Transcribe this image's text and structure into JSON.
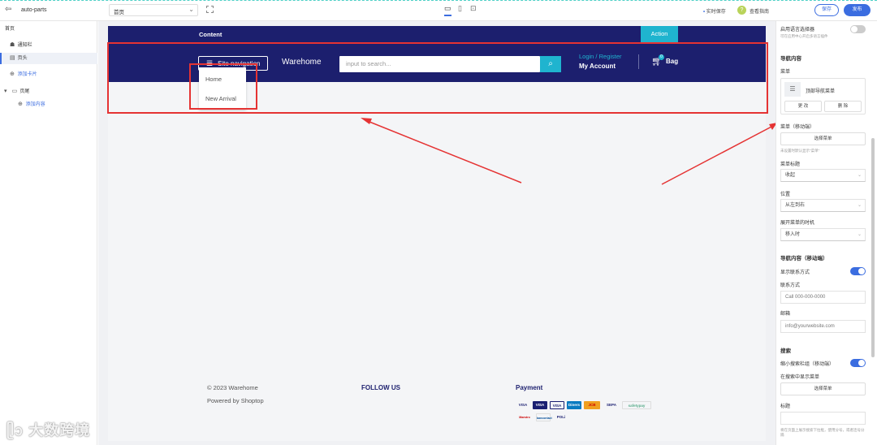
{
  "topbar": {
    "back_icon": "exit-icon",
    "site_name": "auto-parts",
    "page_select": "首页",
    "autosave_label": "实时保存",
    "help_label": "查看指南",
    "save_label": "保存",
    "publish_label": "发布"
  },
  "sidebar": {
    "items": [
      {
        "label": "首页"
      },
      {
        "label": "通知栏"
      },
      {
        "label": "页头"
      },
      {
        "label": "添加卡片"
      },
      {
        "label": "页尾"
      },
      {
        "label": "添加内容"
      }
    ]
  },
  "preview": {
    "content_label": "Content",
    "action_label": "Action",
    "site_navigation": "Site navigation",
    "brand": "Warehome",
    "search_placeholder": "input to search...",
    "login_register": "Login / Register",
    "my_account": "My Account",
    "cart_count": "0",
    "bag_label": "Bag",
    "dropdown": [
      "Home",
      "New Arrival"
    ],
    "footer": {
      "copyright": "© 2023 Warehome",
      "powered": "Powered by Shoptop",
      "follow_us": "FOLLOW US",
      "payment": "Payment",
      "payment_methods": [
        "VISA",
        "VISA",
        "VISA",
        "Diners",
        "JCB",
        "SEPA",
        "safetypay",
        "Maestro",
        "bancontact",
        "POLi"
      ]
    }
  },
  "right_panel": {
    "lang_selector_label": "启用语言选择器",
    "lang_selector_hint": "可在应用中心开启多语言插件",
    "nav_section": "导航内容",
    "menu_label": "菜单",
    "menu_name": "顶部导航菜单",
    "change_label": "更 改",
    "delete_label": "删 除",
    "mobile_menu_label": "菜单（移动端）",
    "select_menu_label": "选择菜单",
    "mobile_menu_hint": "未设置时默认显示\"菜单\"",
    "menu_title_label": "菜单标题",
    "menu_title_value": "收起",
    "position_label": "位置",
    "position_value": "从左到右",
    "expand_label": "展开菜单的时机",
    "expand_value": "移入时",
    "mobile_nav_section": "导航内容（移动端）",
    "show_contact_label": "显示联系方式",
    "contact_label": "联系方式",
    "contact_value": "Call 000-000-0000",
    "email_label": "邮箱",
    "email_value": "info@yourwebsite.com",
    "search_section": "搜索",
    "mobile_search_label": "缩小搜索栏组（移动端）",
    "search_menu_label": "在搜索中显示菜单",
    "select_menu2_label": "选择菜单",
    "title_label": "标题",
    "title_hint": "将在页面上展示搜索下拉框，使用分号，或者连号分隔"
  }
}
